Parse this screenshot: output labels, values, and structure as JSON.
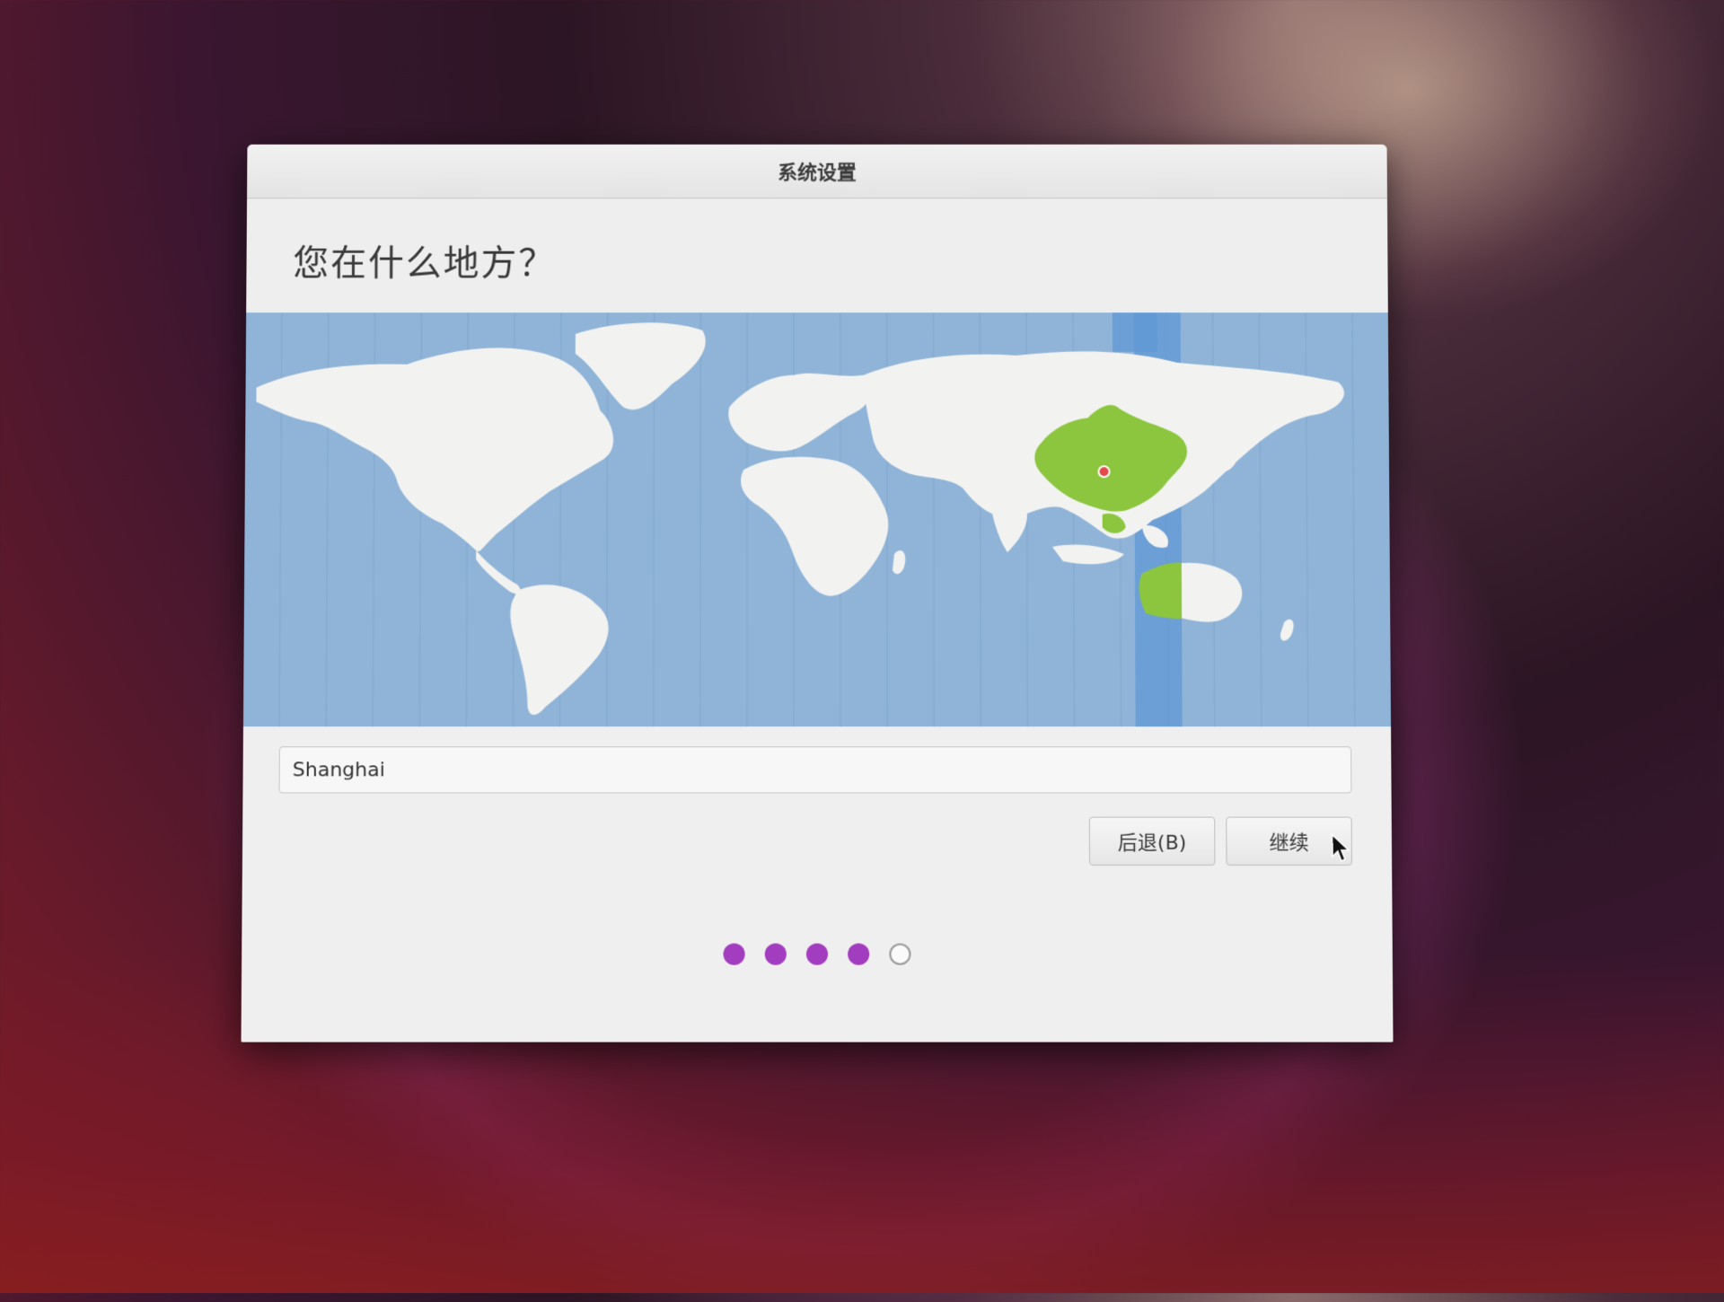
{
  "window": {
    "title": "系统设置"
  },
  "page": {
    "heading": "您在什么地方？"
  },
  "map": {
    "highlighted_region": "China",
    "highlight_color": "#8cc63f",
    "marker_color": "#e24a4a",
    "ocean_color": "#8fb4d8",
    "land_color": "#f2f2f0"
  },
  "location": {
    "value": "Shanghai"
  },
  "buttons": {
    "back_label": "后退(B)",
    "continue_label": "继续"
  },
  "steps": {
    "total": 5,
    "completed": 4,
    "accent": "#a33dbf"
  },
  "icons": {
    "cursor": "mouse-pointer-icon",
    "marker": "location-pin-icon"
  }
}
